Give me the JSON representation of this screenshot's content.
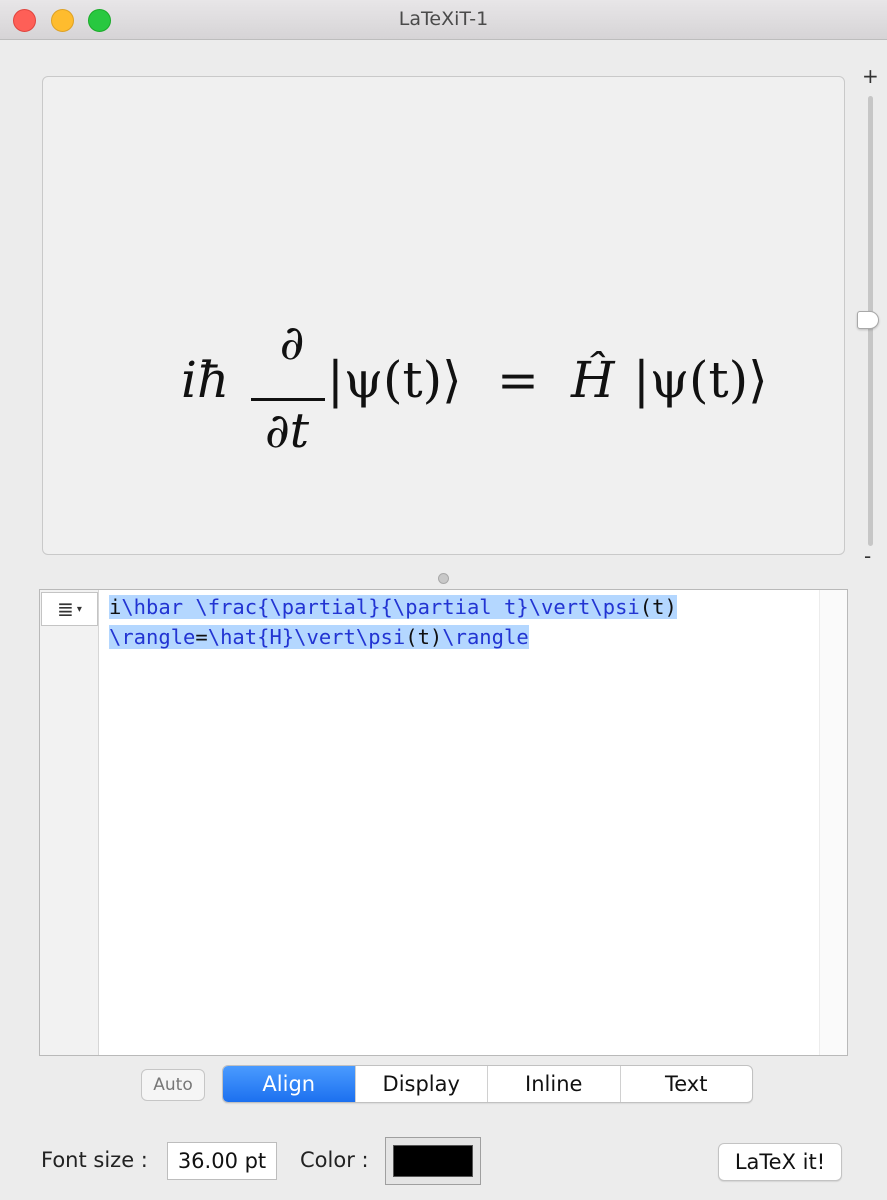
{
  "window": {
    "title": "LaTeXiT-1"
  },
  "preview": {
    "formula_parts": {
      "ihbar": "iħ",
      "numerator": "∂",
      "denominator": "∂t",
      "ket_left": "|ψ(t)⟩",
      "equals": "=",
      "hamiltonian": "Ĥ",
      "ket_right": "|ψ(t)⟩"
    }
  },
  "zoom": {
    "plus_label": "+",
    "minus_label": "-",
    "level": 0.5
  },
  "editor": {
    "menu_glyph": "≣",
    "menu_caret": "▾",
    "line1": [
      {
        "text": "i",
        "kind": "txt"
      },
      {
        "text": "\\hbar",
        "kind": "cmd"
      },
      {
        "text": " ",
        "kind": "txt"
      },
      {
        "text": "\\frac",
        "kind": "cmd"
      },
      {
        "text": "{",
        "kind": "cmd"
      },
      {
        "text": "\\partial",
        "kind": "cmd"
      },
      {
        "text": "}{",
        "kind": "cmd"
      },
      {
        "text": "\\partial",
        "kind": "cmd"
      },
      {
        "text": " t}",
        "kind": "cmd"
      },
      {
        "text": "\\vert",
        "kind": "cmd"
      },
      {
        "text": "\\psi",
        "kind": "cmd"
      },
      {
        "text": "(t)",
        "kind": "txt"
      }
    ],
    "line2": [
      {
        "text": "\\rangle",
        "kind": "cmd"
      },
      {
        "text": "=",
        "kind": "txt"
      },
      {
        "text": "\\hat",
        "kind": "cmd"
      },
      {
        "text": "{H}",
        "kind": "cmd"
      },
      {
        "text": "\\vert",
        "kind": "cmd"
      },
      {
        "text": "\\psi",
        "kind": "cmd"
      },
      {
        "text": "(t)",
        "kind": "txt"
      },
      {
        "text": "\\rangle",
        "kind": "cmd"
      }
    ]
  },
  "modes": {
    "auto_label": "Auto",
    "items": [
      "Align",
      "Display",
      "Inline",
      "Text"
    ],
    "selected": "Align"
  },
  "bottom": {
    "font_size_label": "Font size :",
    "font_size_value": "36.00 pt",
    "color_label": "Color :",
    "color_value": "#000000",
    "latex_button": "LaTeX it!"
  },
  "colors": {
    "accent": "#1c70ef",
    "selection": "#b4d7ff",
    "command_text": "#2234d2"
  }
}
